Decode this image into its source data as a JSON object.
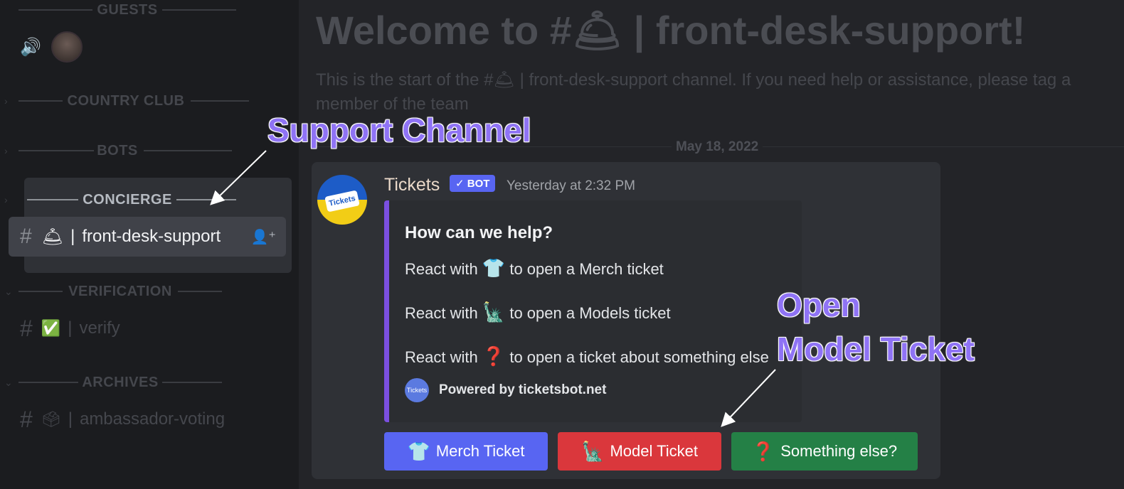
{
  "sidebar": {
    "categories": {
      "guests": "GUESTS",
      "country_club": "COUNTRY CLUB",
      "bots": "BOTS",
      "concierge": "CONCIERGE",
      "verification": "VERIFICATION",
      "archives": "ARCHIVES"
    },
    "channels": {
      "front_desk": {
        "emoji": "🛎",
        "name": "front-desk-support"
      },
      "verify": {
        "emoji": "✅",
        "name": "verify"
      },
      "ambassador": {
        "emoji": "🗳",
        "name": "ambassador-voting"
      }
    }
  },
  "main": {
    "welcome": "Welcome to #🛎 | front-desk-support!",
    "intro": "This is the start of the #🛎 | front-desk-support channel. If you need help or assistance, please tag a member of the team",
    "date_divider": "May 18, 2022"
  },
  "message": {
    "author": "Tickets",
    "bot_badge": "✓ BOT",
    "timestamp": "Yesterday at 2:32 PM",
    "avatar_text": "Tickets",
    "embed": {
      "title": "How can we help?",
      "line1_prefix": "React with",
      "line1_emoji": "👕",
      "line1_suffix": "to open a Merch ticket",
      "line2_prefix": "React with",
      "line2_emoji": "🗽",
      "line2_suffix": "to open a Models ticket",
      "line3_prefix": "React with",
      "line3_emoji": "❓",
      "line3_suffix": "to open a ticket about something else",
      "footer_icon_text": "Tickets",
      "footer": "Powered by ticketsbot.net"
    },
    "buttons": {
      "merch": {
        "emoji": "👕",
        "label": "Merch Ticket"
      },
      "model": {
        "emoji": "🗽",
        "label": "Model Ticket"
      },
      "else": {
        "emoji": "❓",
        "label": "Something else?"
      }
    }
  },
  "annotations": {
    "support_channel": "Support Channel",
    "open_model_line1": "Open",
    "open_model_line2": "Model Ticket"
  },
  "colors": {
    "blurple": "#5865f2",
    "red": "#da373c",
    "green": "#248046",
    "annotation": "#8f73f5",
    "embed_bar": "#7b4fe0"
  }
}
